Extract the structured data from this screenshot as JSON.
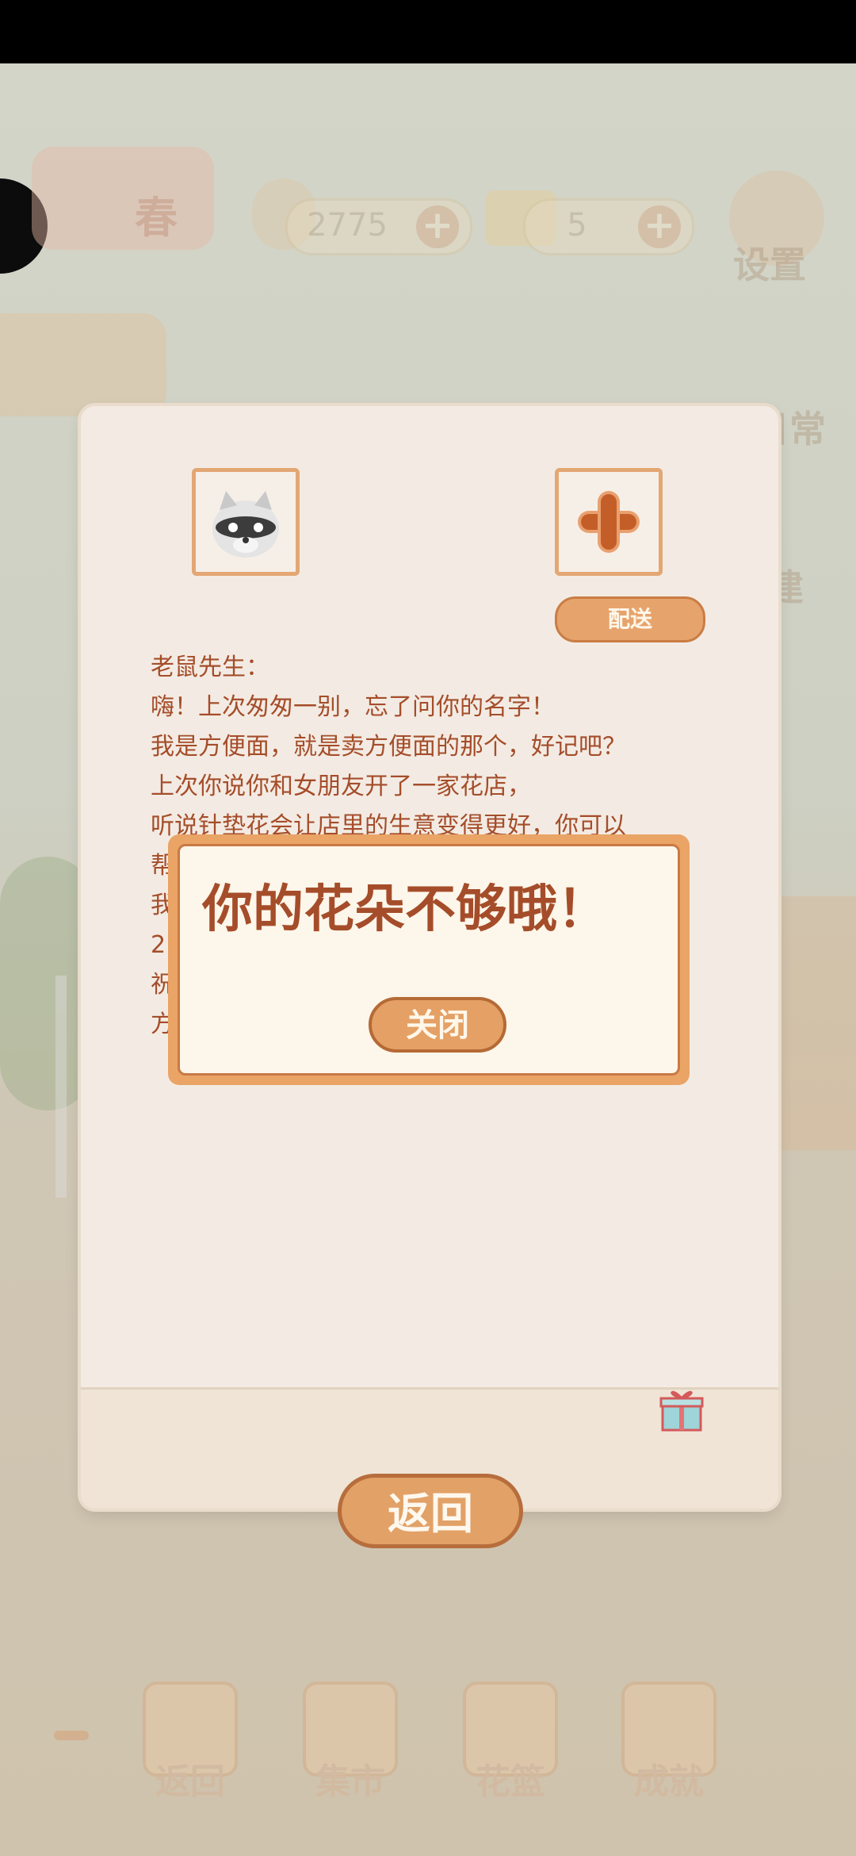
{
  "hud": {
    "season_label": "春",
    "fish_count": "2775",
    "cheese_count": "5",
    "settings_label": "设置",
    "daily_label": "日常",
    "build_label": "建"
  },
  "letter": {
    "deliver_label": "配送",
    "lines": [
      "老鼠先生：",
      "嗨！上次匆匆一别，忘了问你的名字！",
      "我是方便面，就是卖方便面的那个，好记吧？",
      "上次你说你和女朋友开了一家花店，",
      "听说针垫花会让店里的生意变得更好，你可以",
      "帮",
      "我",
      "2",
      "祝",
      "方"
    ],
    "back_label": "返回"
  },
  "dialog": {
    "message": "你的花朵不够哦！",
    "close_label": "关闭"
  },
  "nav": [
    {
      "label": "返回"
    },
    {
      "label": "集市"
    },
    {
      "label": "花篮"
    },
    {
      "label": "成就"
    }
  ]
}
